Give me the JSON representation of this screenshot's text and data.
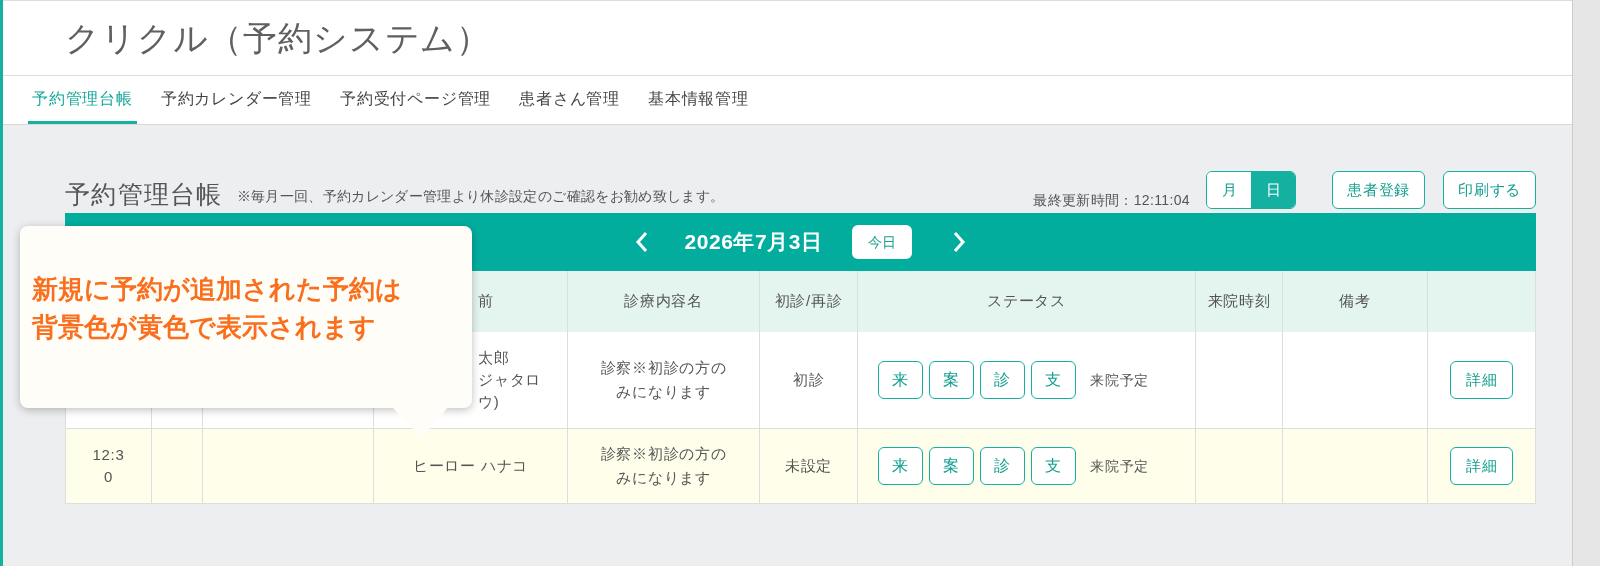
{
  "app_title": "クリクル（予約システム）",
  "tabs": [
    {
      "label": "予約管理台帳",
      "selected": true
    },
    {
      "label": "予約カレンダー管理",
      "selected": false
    },
    {
      "label": "予約受付ページ管理",
      "selected": false
    },
    {
      "label": "患者さん管理",
      "selected": false
    },
    {
      "label": "基本情報管理",
      "selected": false
    }
  ],
  "page_title": "予約管理台帳",
  "notice": "※毎月一回、予約カレンダー管理より休診設定のご確認をお勧め致します。",
  "last_updated": "最終更新時間：12:11:04",
  "view_toggle": [
    {
      "label": "月",
      "selected": false
    },
    {
      "label": "日",
      "selected": true
    }
  ],
  "actions": [
    "患者登録",
    "印刷する"
  ],
  "date_nav": {
    "date": "2026年7月3日",
    "today": "今日"
  },
  "columns": [
    "",
    "",
    "",
    "前",
    "診療内容名",
    "初診/再診",
    "ステータス",
    "来院時刻",
    "備考",
    ""
  ],
  "rows": [
    {
      "highlight": false,
      "time": "",
      "name_lines": [
        "太郎",
        "ジャタロ",
        "ウ)"
      ],
      "treatment": "診察※初診の方のみになります",
      "visit_type": "初診",
      "status_buttons": [
        "来",
        "案",
        "診",
        "支"
      ],
      "status": "来院予定",
      "detail": "詳細"
    },
    {
      "highlight": true,
      "time": "12:30",
      "name_lines": [
        "ヒーロー ハナコ"
      ],
      "treatment": "診察※初診の方のみになります",
      "visit_type": "未設定",
      "status_buttons": [
        "来",
        "案",
        "診",
        "支"
      ],
      "status": "来院予定",
      "detail": "詳細"
    }
  ],
  "callout": {
    "lines": [
      "新規に予約が追加された予約は",
      "背景色が黄色で表示されます"
    ]
  }
}
